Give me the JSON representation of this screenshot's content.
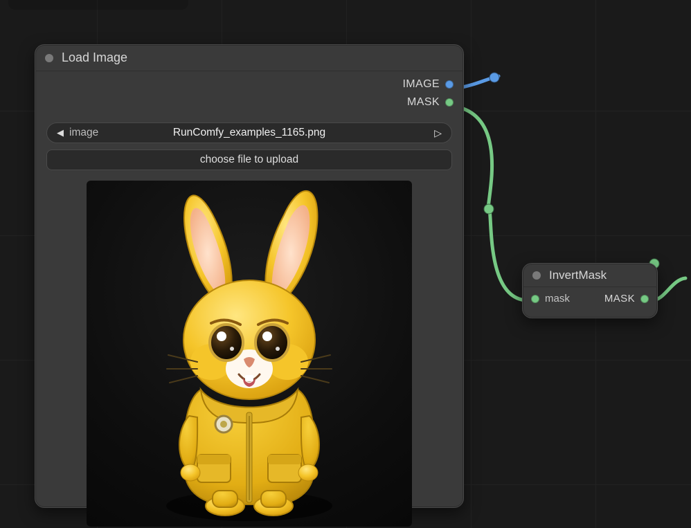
{
  "nodes": {
    "load_image": {
      "title": "Load Image",
      "outputs": {
        "image": "IMAGE",
        "mask": "MASK"
      },
      "widgets": {
        "select_label": "image",
        "select_value": "RunComfy_examples_1165.png",
        "upload_button": "choose file to upload"
      }
    },
    "invert_mask": {
      "title": "InvertMask",
      "input": "mask",
      "output": "MASK"
    }
  },
  "colors": {
    "image_port": "#5a9be6",
    "mask_port": "#76c984",
    "link_image": "#5a9be6",
    "link_mask": "#76c984"
  }
}
